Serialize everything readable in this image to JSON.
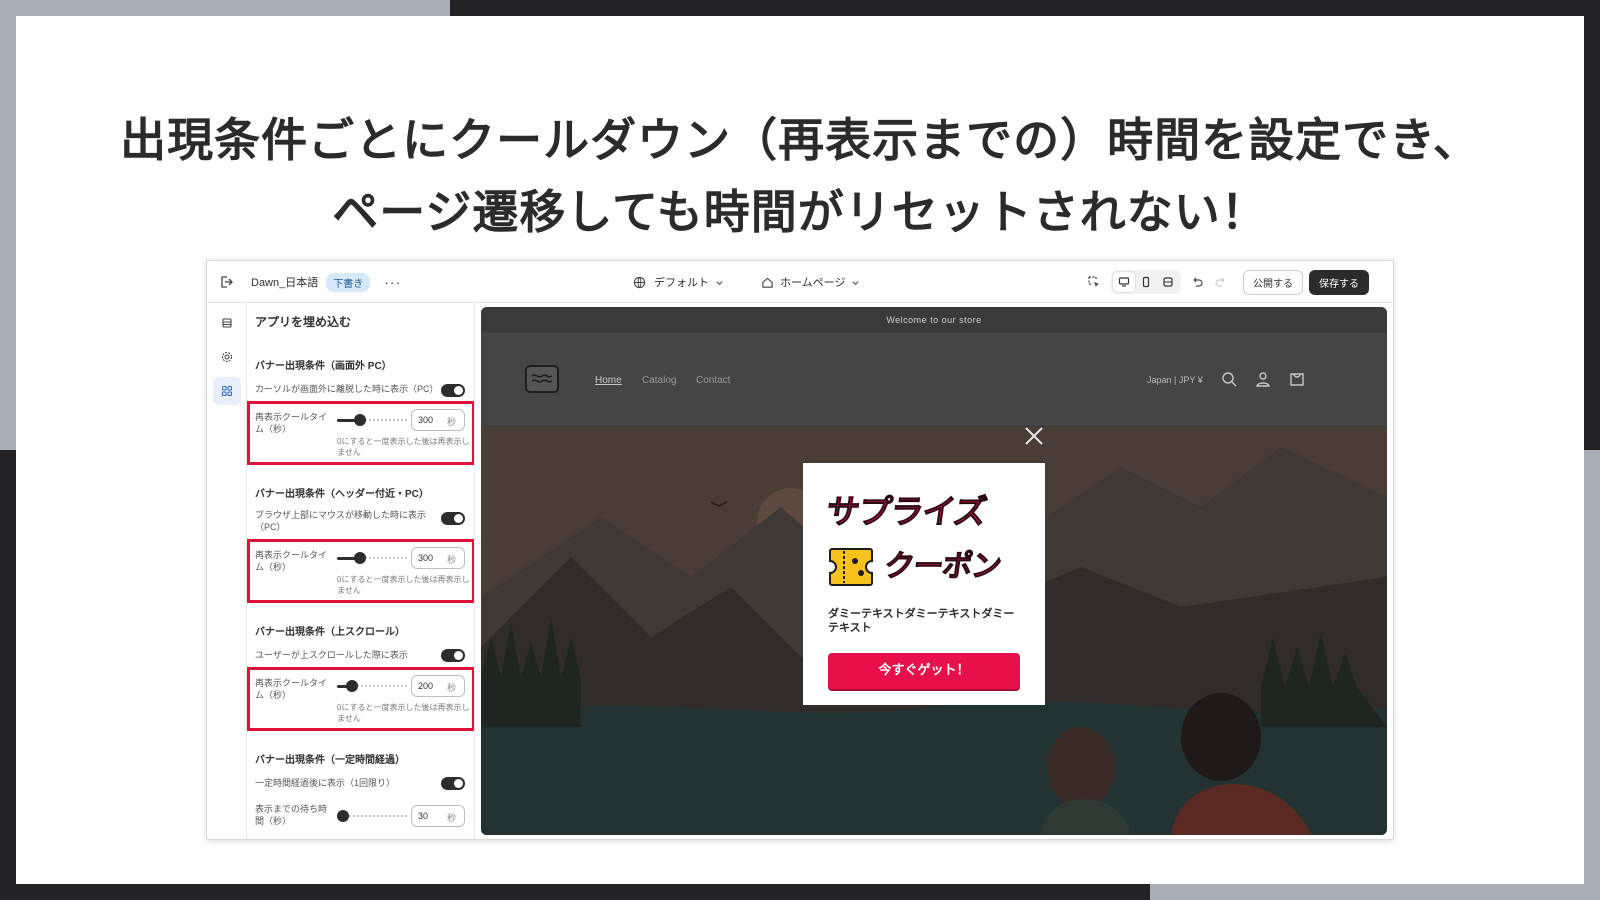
{
  "slide": {
    "headline_line1": "出現条件ごとにクールダウン（再表示までの）時間を設定でき、",
    "headline_line2": "ページ遷移しても時間がリセットされない！"
  },
  "editor": {
    "theme_name": "Dawn_日本語",
    "theme_status": "下書き",
    "more_label": "···",
    "locale_selector": "デフォルト",
    "page_selector": "ホームページ",
    "publish_label": "公開する",
    "save_label": "保存する"
  },
  "panel": {
    "title": "アプリを埋め込む",
    "sections": [
      {
        "heading": "バナー出現条件（画面外 PC）",
        "toggle_label": "カーソルが画面外に離脱した時に表示（PC）",
        "toggle_on": true,
        "field_label": "再表示クールタイム（秒）",
        "value": "300",
        "unit": "秒",
        "hint": "0にすると一度表示した後は再表示しません",
        "slider_fraction": 0.33
      },
      {
        "heading": "バナー出現条件（ヘッダー付近・PC）",
        "toggle_label": "ブラウザ上部にマウスが移動した時に表示（PC）",
        "toggle_on": true,
        "field_label": "再表示クールタイム（秒）",
        "value": "300",
        "unit": "秒",
        "hint": "0にすると一度表示した後は再表示しません",
        "slider_fraction": 0.33
      },
      {
        "heading": "バナー出現条件（上スクロール）",
        "toggle_label": "ユーザーが上スクロールした際に表示",
        "toggle_on": true,
        "field_label": "再表示クールタイム（秒）",
        "value": "200",
        "unit": "秒",
        "hint": "0にすると一度表示した後は再表示しません",
        "slider_fraction": 0.22
      },
      {
        "heading": "バナー出現条件（一定時間経過）",
        "toggle_label": "一定時間経過後に表示（1回限り）",
        "toggle_on": true,
        "field_label": "表示までの待ち時間（秒）",
        "value": "30",
        "unit": "秒",
        "slider_fraction": 0.08
      }
    ]
  },
  "preview": {
    "announcement": "Welcome to our store",
    "nav": [
      "Home",
      "Catalog",
      "Contact"
    ],
    "locale": "Japan | JPY ¥",
    "popup": {
      "headline_1": "サプライズ",
      "headline_2": "クーポン",
      "body": "ダミーテキストダミーテキストダミーテキスト",
      "cta": "今すぐゲット！"
    }
  },
  "colors": {
    "highlight_border": "#e0103c",
    "cta": "#e8104a",
    "save_button": "#2b2b2b",
    "draft_badge": "#d6e9fb"
  },
  "icons": [
    "exit-icon",
    "more-icon",
    "globe-icon",
    "home-icon",
    "chevron-down-icon",
    "inspector-icon",
    "desktop-icon",
    "mobile-icon",
    "fullwidth-icon",
    "undo-icon",
    "redo-icon",
    "sections-icon",
    "settings-gear-icon",
    "apps-icon",
    "search-icon",
    "account-icon",
    "cart-icon",
    "close-icon",
    "coupon-icon"
  ]
}
